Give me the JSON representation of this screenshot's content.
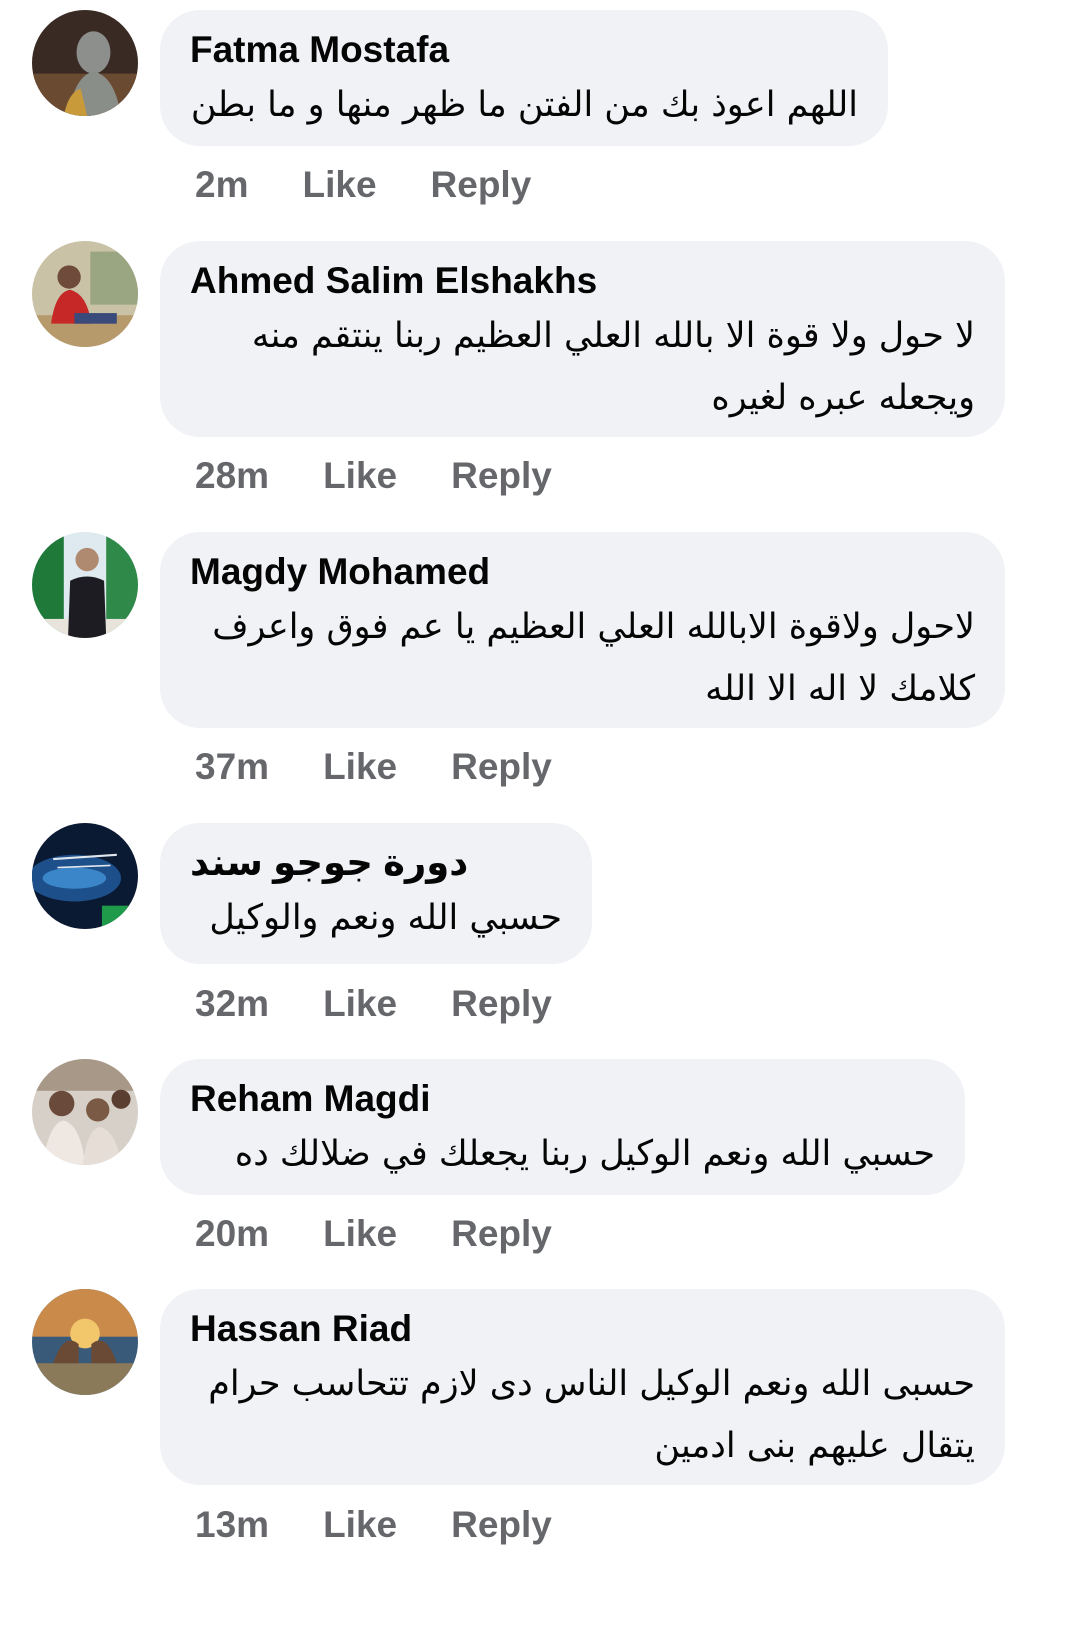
{
  "comments": [
    {
      "author": "Fatma Mostafa",
      "text": "اللهم اعوذ بك من الفتن ما ظهر منها و ما بطن",
      "time": "2m",
      "like": "Like",
      "reply": "Reply"
    },
    {
      "author": "Ahmed Salim Elshakhs",
      "text": "لا حول ولا قوة الا بالله العلي العظيم ربنا ينتقم منه ويجعله عبره لغيره",
      "time": "28m",
      "like": "Like",
      "reply": "Reply"
    },
    {
      "author": "Magdy Mohamed",
      "text": "لاحول ولاقوة الابالله العلي العظيم يا عم فوق واعرف كلامك لا اله الا الله",
      "time": "37m",
      "like": "Like",
      "reply": "Reply"
    },
    {
      "author": "دورة جوجو سند",
      "text": "حسبي الله ونعم والوكيل",
      "time": "32m",
      "like": "Like",
      "reply": "Reply"
    },
    {
      "author": "Reham Magdi",
      "text": "حسبي الله ونعم الوكيل  ربنا يجعلك في ضلالك ده",
      "time": "20m",
      "like": "Like",
      "reply": "Reply"
    },
    {
      "author": "Hassan Riad",
      "text": "حسبى الله  ونعم الوكيل الناس دى لازم تتحاسب حرام يتقال عليهم بنى ادمين",
      "time": "13m",
      "like": "Like",
      "reply": "Reply"
    }
  ]
}
